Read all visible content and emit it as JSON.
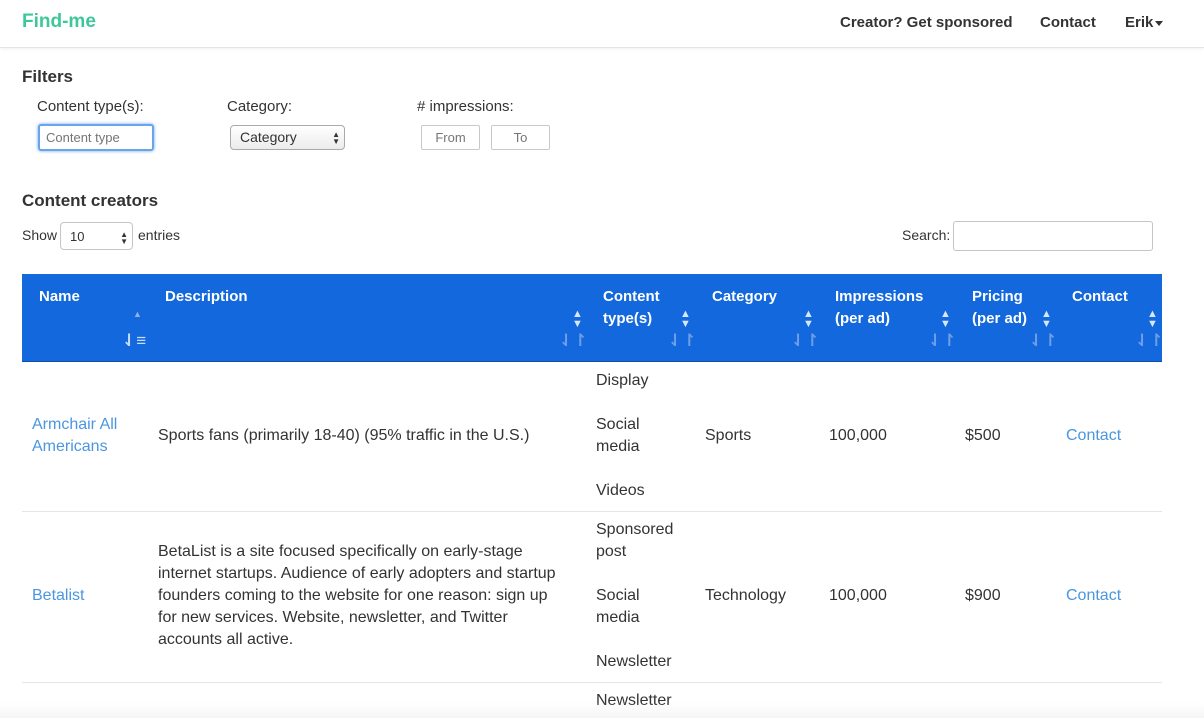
{
  "navbar": {
    "brand": "Find-me",
    "sponsor_link": "Creator? Get sponsored",
    "contact_link": "Contact",
    "user_menu": "Erik"
  },
  "filters": {
    "heading": "Filters",
    "content_type_label": "Content type(s):",
    "content_type_placeholder": "Content type",
    "category_label": "Category:",
    "category_value": "Category",
    "impressions_label": "# impressions:",
    "from_placeholder": "From",
    "to_placeholder": "To"
  },
  "creators": {
    "heading": "Content creators",
    "show_label": "Show",
    "entries_value": "10",
    "entries_label": "entries",
    "search_label": "Search:"
  },
  "table": {
    "columns": [
      {
        "label": "Name"
      },
      {
        "label": "Description"
      },
      {
        "label": "Content type(s)"
      },
      {
        "label": "Category"
      },
      {
        "label": "Impressions (per ad)"
      },
      {
        "label": "Pricing (per ad)"
      },
      {
        "label": "Contact"
      }
    ],
    "rows": [
      {
        "name": "Armchair All Americans",
        "description": "Sports fans (primarily 18-40) (95% traffic in the U.S.)",
        "content_types": [
          "Display",
          "Social media",
          "Videos"
        ],
        "category": "Sports",
        "impressions": "100,000",
        "pricing": "$500",
        "contact": "Contact"
      },
      {
        "name": "Betalist",
        "description": "BetaList is a site focused specifically on early-stage internet startups. Audience of early adopters and startup founders coming to the website for one reason: sign up for new services. Website, newsletter, and Twitter accounts all active.",
        "content_types": [
          "Sponsored post",
          "Social media",
          "Newsletter"
        ],
        "category": "Technology",
        "impressions": "100,000",
        "pricing": "$900",
        "contact": "Contact"
      },
      {
        "content_types": [
          "Newsletter"
        ]
      }
    ]
  },
  "colors": {
    "brand": "#3fc79c",
    "header_bg": "#1268dc",
    "link": "#4a96e0"
  }
}
